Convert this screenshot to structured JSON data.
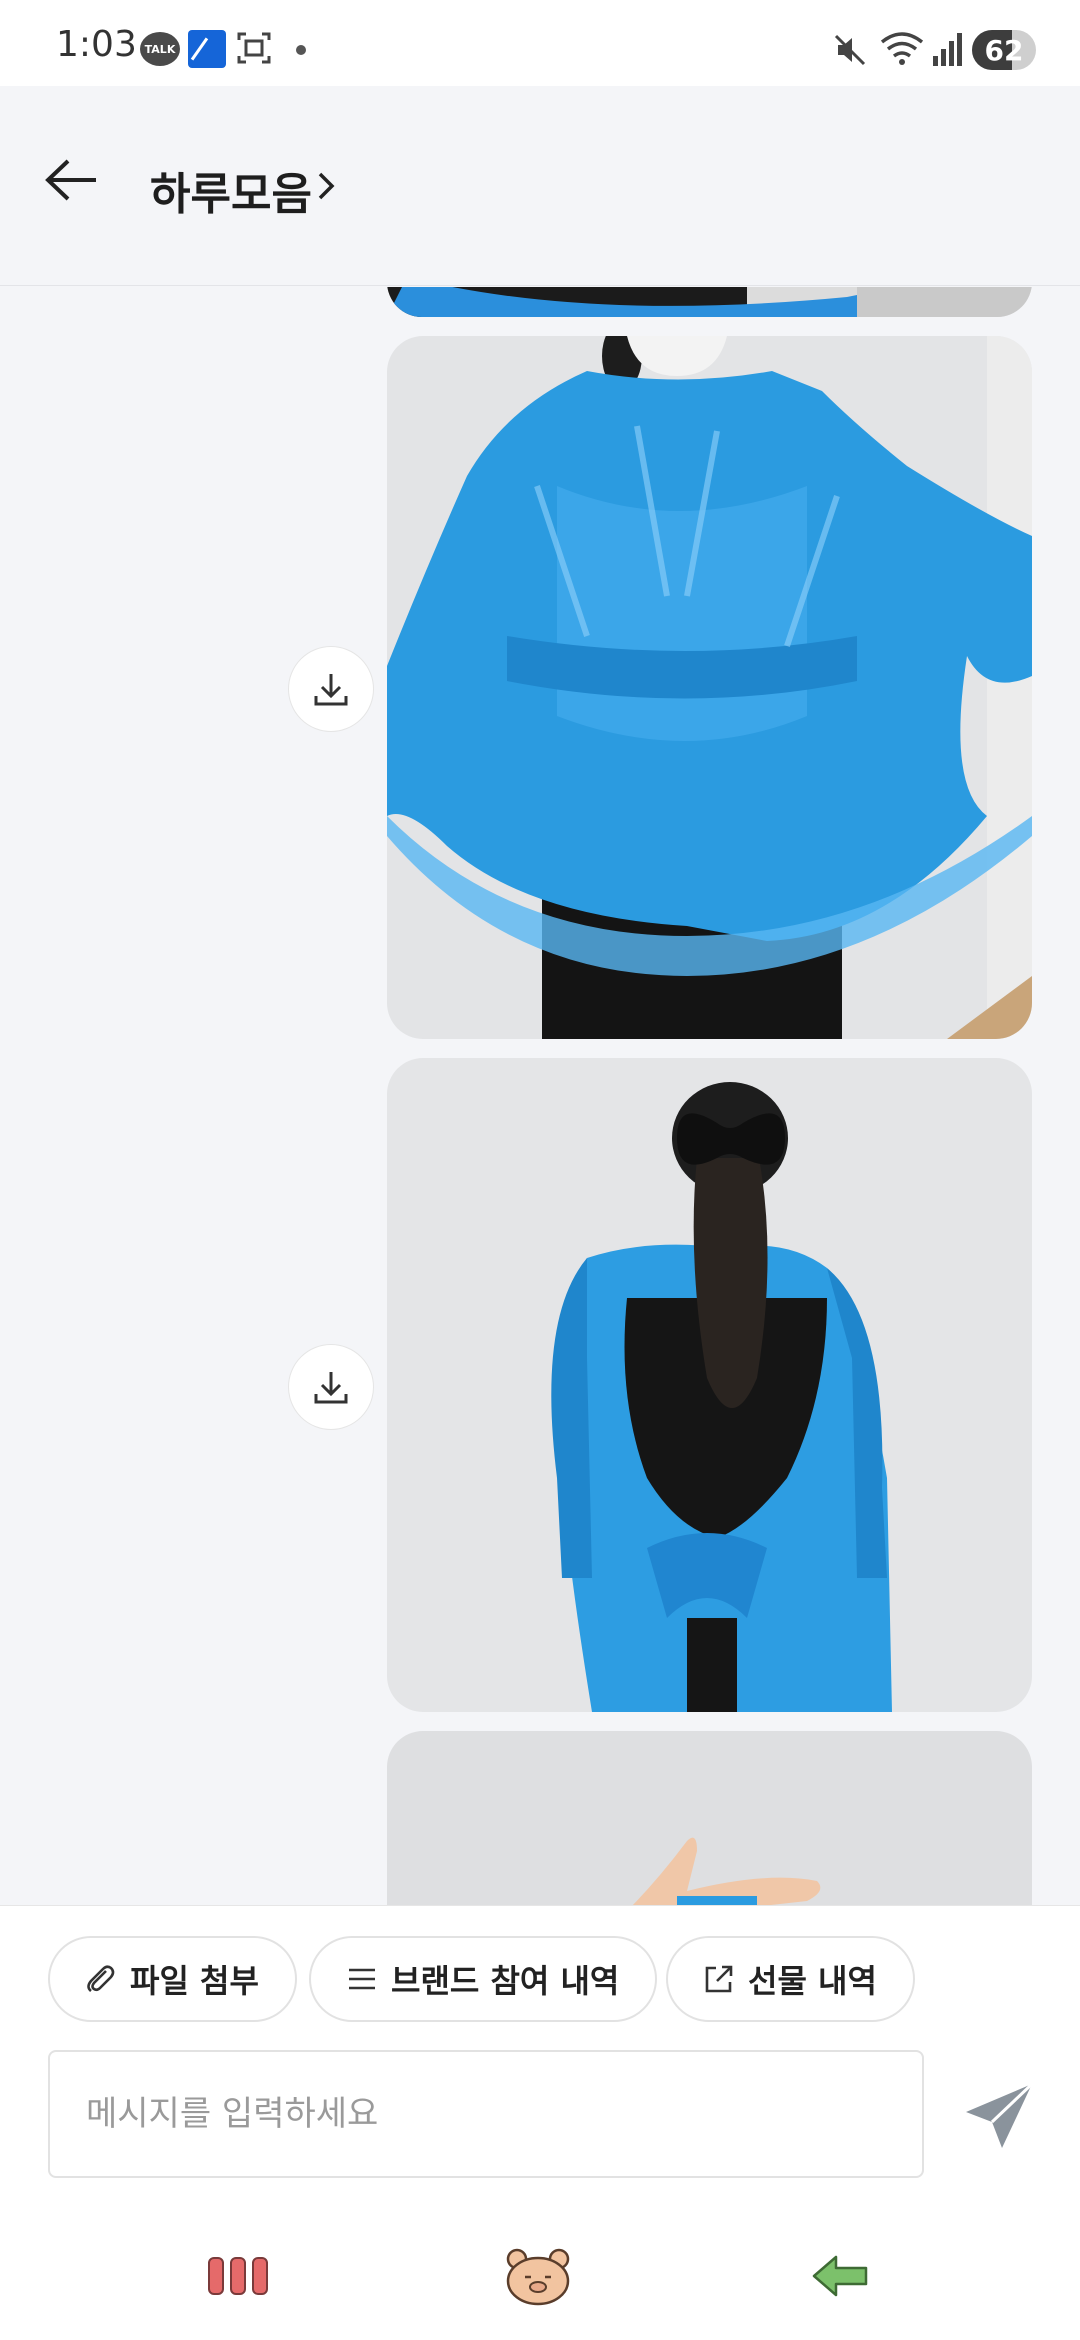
{
  "status_bar": {
    "time": "1:03",
    "talk_badge": "TALK",
    "battery_level": "62",
    "battery_fraction": 0.62
  },
  "header": {
    "title": "하루모음"
  },
  "messages": {
    "photos": [
      {
        "description": "blue-gown-partial-top"
      },
      {
        "description": "blue-gown-front"
      },
      {
        "description": "blue-gown-back"
      },
      {
        "description": "blue-gown-partial-bottom"
      }
    ]
  },
  "actions": {
    "attach_file": "파일 첨부",
    "brand_history": "브랜드 참여 내역",
    "gift_history": "선물 내역"
  },
  "composer": {
    "placeholder": "메시지를 입력하세요"
  },
  "colors": {
    "gown_blue": "#2b9be0",
    "background": "#f4f5f8",
    "nav_recent": "#e56a6a",
    "nav_back": "#7cc16b"
  },
  "icons": {
    "back": "back-arrow-icon",
    "title_chevron": "chevron-right-icon",
    "download": "download-icon",
    "attach": "paperclip-icon",
    "list": "list-icon",
    "external": "external-link-icon",
    "send": "send-icon"
  }
}
